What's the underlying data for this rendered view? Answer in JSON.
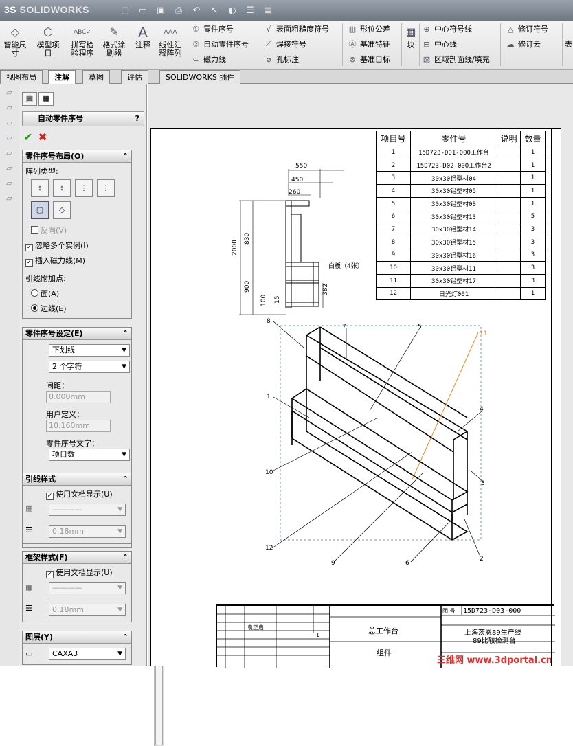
{
  "app": {
    "logo_prefix": "3S",
    "logo_name": "SOLIDWORKS"
  },
  "quick_access": [
    "new-icon",
    "open-icon",
    "save-icon",
    "print-icon",
    "undo-icon",
    "select-icon",
    "rebuild-icon",
    "file-props-icon",
    "options-icon"
  ],
  "ribbon": {
    "big": [
      {
        "label": "智能尺寸",
        "icon": "smart-dimension-icon"
      },
      {
        "label": "模型项目",
        "icon": "model-items-icon"
      },
      {
        "label": "拼写检验程序",
        "icon": "spell-check-icon"
      },
      {
        "label": "格式涂刷器",
        "icon": "format-painter-icon"
      },
      {
        "label": "注释",
        "icon": "note-icon"
      },
      {
        "label": "线性注释阵列",
        "icon": "linear-note-pattern-icon"
      }
    ],
    "col1": [
      "零件序号",
      "自动零件序号",
      "磁力线"
    ],
    "col2": [
      "表面粗糙度符号",
      "焊接符号",
      "孔标注"
    ],
    "col3": [
      "形位公差",
      "基准特征",
      "基准目标"
    ],
    "block": "块",
    "col4": [
      "中心符号线",
      "中心线",
      "区域剖面线/填充"
    ],
    "col5": [
      "修订符号",
      "修订云"
    ],
    "cut": "表"
  },
  "tabs": [
    "视图布局",
    "注解",
    "草图",
    "评估",
    "SOLIDWORKS 插件"
  ],
  "active_tab": "注解",
  "pm": {
    "title": "自动零件序号",
    "help": "?",
    "ok": "✔",
    "cancel": "✖",
    "layout": {
      "header": "零件序号布局(O)",
      "pattern_type": "阵列类型:",
      "reverse": "反向(V)",
      "ignore_multi": "忽略多个实例(I)",
      "insert_magnetic": "插入磁力线(M)",
      "leader_attach": "引线附加点:",
      "faces": "面(A)",
      "edges": "边线(E)"
    },
    "settings": {
      "header": "零件序号设定(E)",
      "style": "下划线",
      "size": "2 个字符",
      "spacing_label": "间距：",
      "spacing_value": "0.000mm",
      "user_label": "用户定义：",
      "user_value": "10.160mm",
      "text_label": "零件序号文字：",
      "text_value": "项目数"
    },
    "leader": {
      "header": "引线样式",
      "use_doc": "使用文档显示(U)",
      "width": "0.18mm"
    },
    "frame": {
      "header": "框架样式(F)",
      "use_doc": "使用文档显示(U)",
      "width": "0.18mm"
    },
    "layer": {
      "header": "图层(Y)",
      "value": "CAXA3"
    }
  },
  "bom": {
    "headers": [
      "项目号",
      "零件号",
      "说明",
      "数量"
    ],
    "rows": [
      [
        "1",
        "15D723-D01-000工作台",
        "",
        "1"
      ],
      [
        "2",
        "15D723-D02-000工作台2",
        "",
        "1"
      ],
      [
        "3",
        "30x30铝型材04",
        "",
        "1"
      ],
      [
        "4",
        "30x30铝型材05",
        "",
        "1"
      ],
      [
        "5",
        "30x30铝型材08",
        "",
        "1"
      ],
      [
        "6",
        "30x30铝型材13",
        "",
        "5"
      ],
      [
        "7",
        "30x30铝型材14",
        "",
        "3"
      ],
      [
        "8",
        "30x30铝型材15",
        "",
        "3"
      ],
      [
        "9",
        "30x30铝型材16",
        "",
        "3"
      ],
      [
        "10",
        "30x30铝型材11",
        "",
        "3"
      ],
      [
        "11",
        "30x30铝型材17",
        "",
        "3"
      ],
      [
        "12",
        "日光灯001",
        "",
        "1"
      ]
    ]
  },
  "dims": {
    "d550": "550",
    "d450": "450",
    "d260": "260",
    "d2000": "2000",
    "d830": "830",
    "d900": "900",
    "d382": "382",
    "d100": "100",
    "d15": "15",
    "plate": "白板（4张）"
  },
  "balloons": [
    "8",
    "7",
    "5",
    "11",
    "1",
    "4",
    "10",
    "3",
    "12",
    "9",
    "6",
    "2"
  ],
  "titleblock": {
    "drawing_no_label": "图 号",
    "drawing_no": "15D723-D03-000",
    "name": "总工作台",
    "assembly": "组件",
    "project1": "上海茨恩89生产线",
    "project2": "89比较检测台",
    "designer": "袁正启",
    "qty": "1"
  },
  "watermark": "三维网 www.3dportal.cn"
}
